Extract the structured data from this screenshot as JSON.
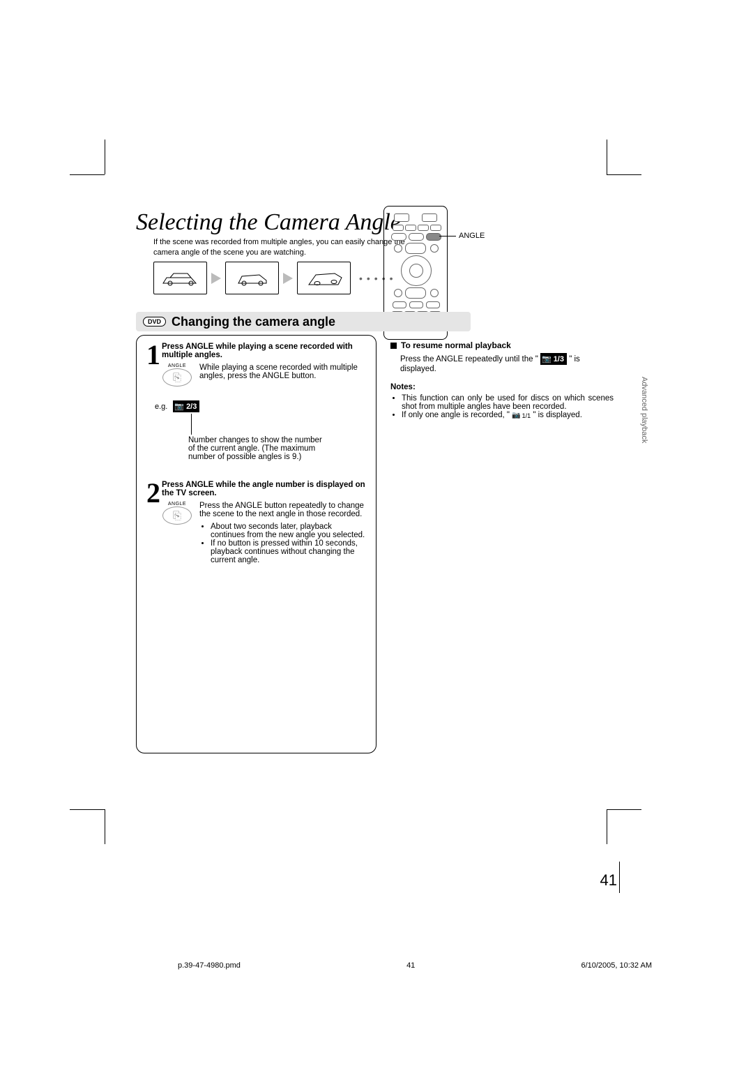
{
  "title": "Selecting the Camera Angle",
  "intro": "If the scene was recorded from multiple angles, you can easily change the camera angle of the scene you are watching.",
  "remote_label": "ANGLE",
  "section": {
    "dvd_chip": "DVD",
    "heading": "Changing the camera angle"
  },
  "step1": {
    "num": "1",
    "heading": "Press ANGLE while playing a scene recorded with multiple angles.",
    "button_label": "ANGLE",
    "desc": "While playing a scene recorded with multiple angles, press the ANGLE button.",
    "eg_label": "e.g.",
    "chip_text": "2/3",
    "note_under": "Number changes to show the number of the current angle. (The maximum number of possible angles is 9.)"
  },
  "step2": {
    "num": "2",
    "heading": "Press ANGLE while the angle number is displayed on the TV screen.",
    "button_label": "ANGLE",
    "desc": "Press the ANGLE button repeatedly to change the scene to the next angle in those recorded.",
    "bullets": [
      "About two seconds later, playback continues from the new angle you selected.",
      "If no button is pressed within 10 seconds, playback continues without changing the current angle."
    ]
  },
  "resume": {
    "heading": "To resume normal playback",
    "line": "Press the ANGLE repeatedly until the \" ",
    "chip": "1/3",
    "after": " \" is displayed."
  },
  "notes": {
    "heading": "Notes:",
    "items": [
      "This function can only be used for discs on which scenes shot from multiple angles have been recorded.",
      "If only one angle is recorded, \" "
    ],
    "single_chip": "1/1",
    "after": " \" is displayed."
  },
  "tab": "Advanced playback",
  "page_number": "41",
  "footer": {
    "file": "p.39-47-4980.pmd",
    "page": "41",
    "timestamp": "6/10/2005, 10:32 AM"
  }
}
